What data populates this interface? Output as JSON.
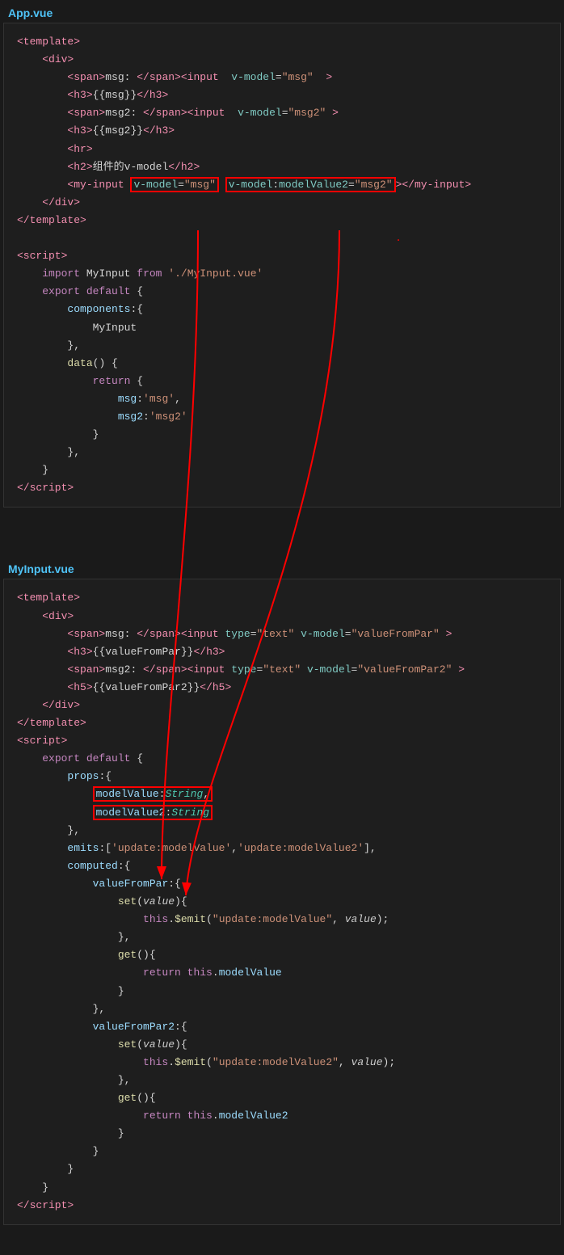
{
  "appVue": {
    "title": "App.vue",
    "code": []
  },
  "myInputVue": {
    "title": "MyInput.vue",
    "code": []
  }
}
